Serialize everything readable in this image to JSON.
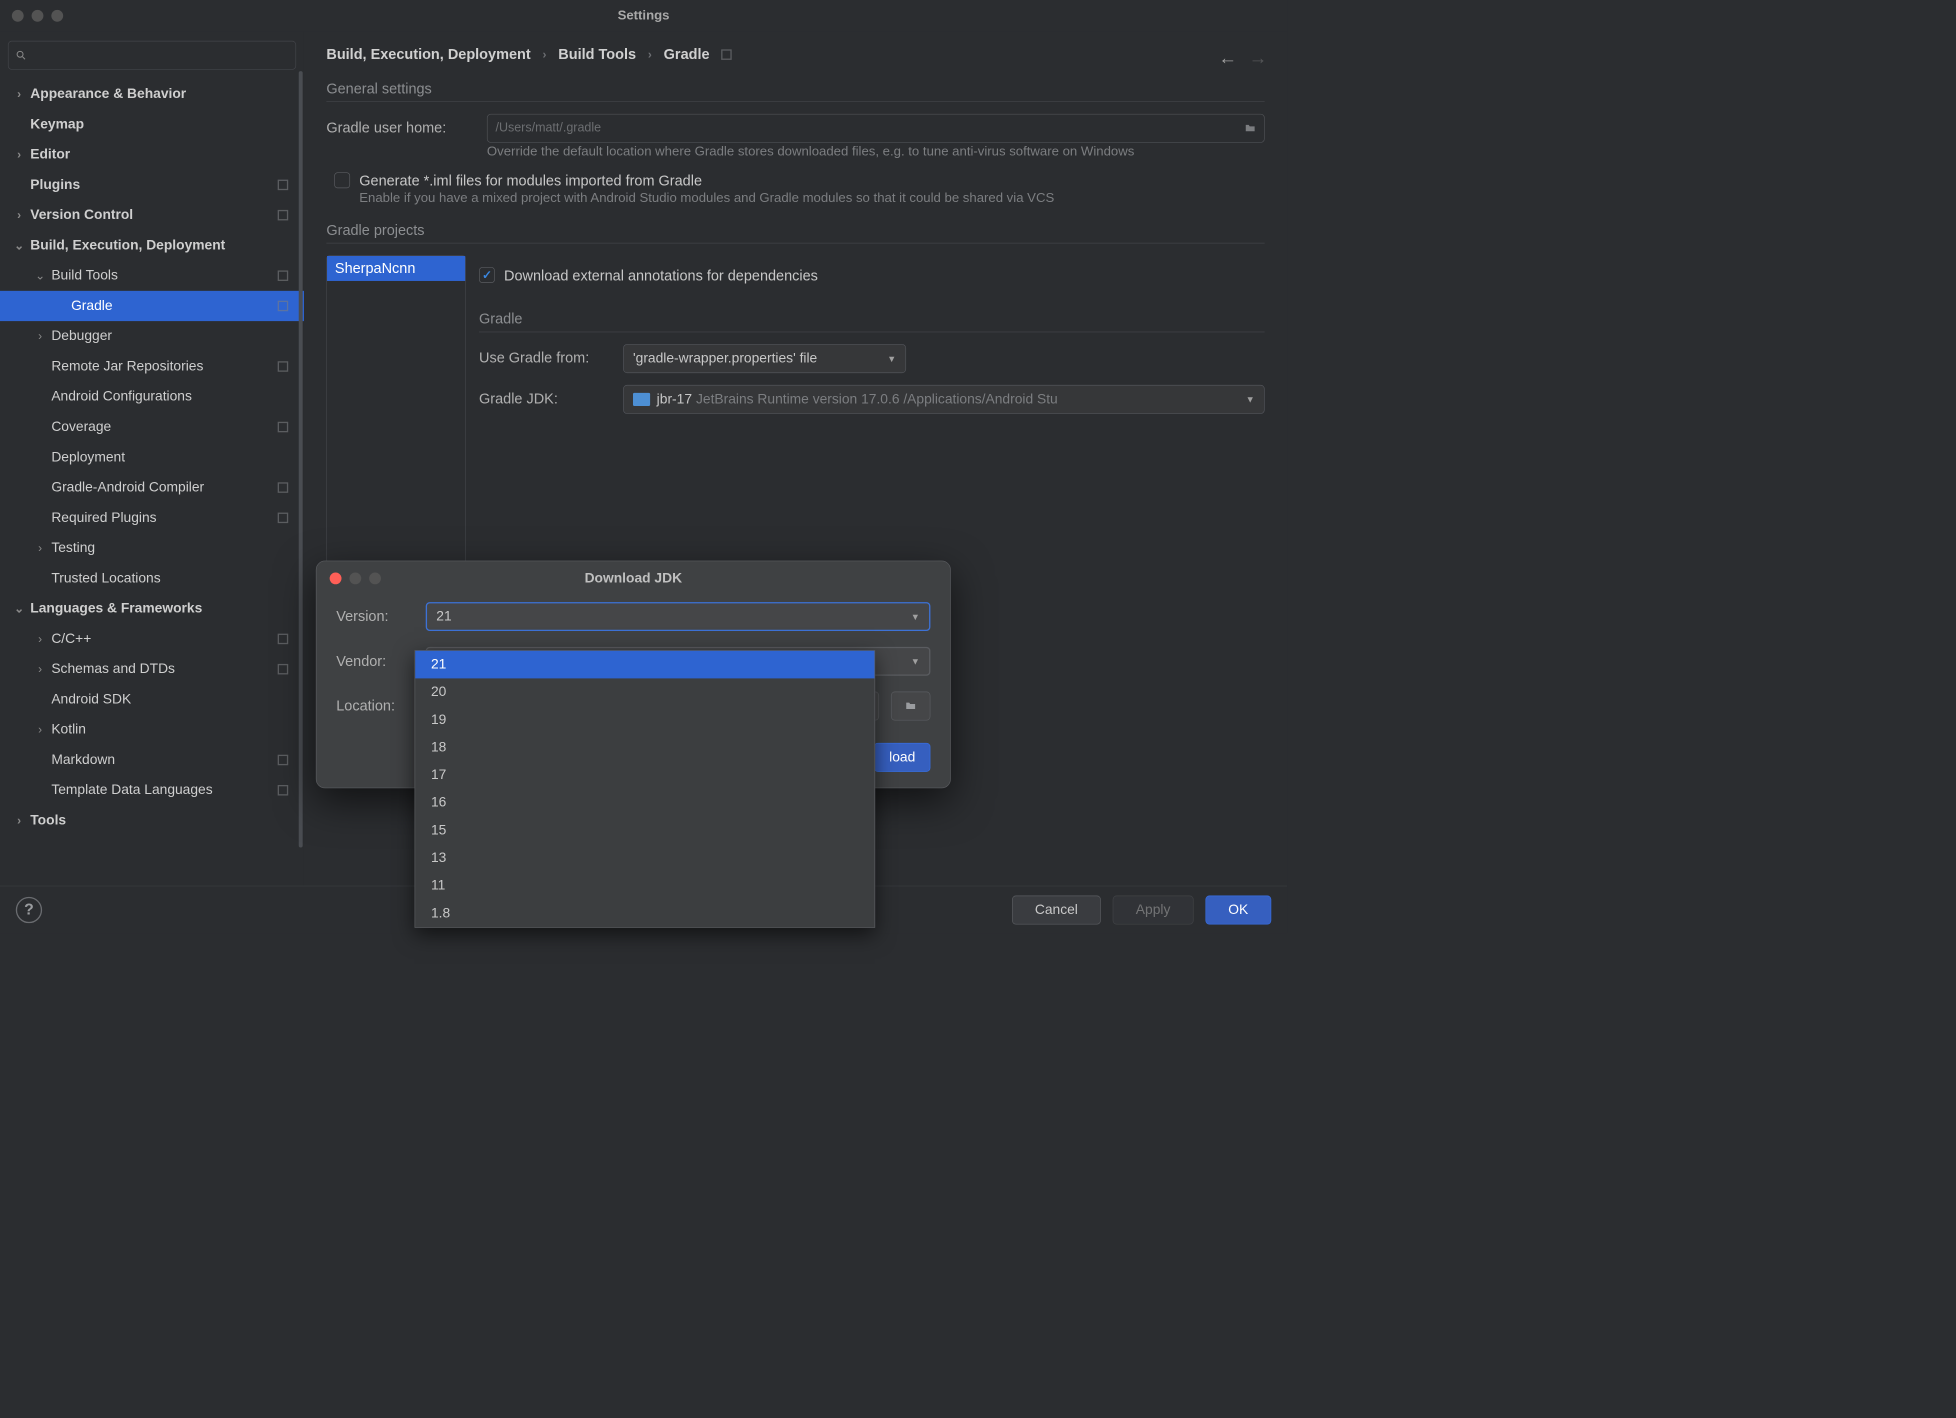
{
  "window": {
    "title": "Settings"
  },
  "breadcrumbs": {
    "a": "Build, Execution, Deployment",
    "b": "Build Tools",
    "c": "Gradle"
  },
  "sidebar": {
    "items": [
      {
        "label": "Appearance & Behavior",
        "level": 1,
        "bold": true,
        "expand": "right"
      },
      {
        "label": "Keymap",
        "level": 1,
        "bold": true
      },
      {
        "label": "Editor",
        "level": 1,
        "bold": true,
        "expand": "right"
      },
      {
        "label": "Plugins",
        "level": 1,
        "bold": true,
        "icon": true
      },
      {
        "label": "Version Control",
        "level": 1,
        "bold": true,
        "expand": "right",
        "icon": true
      },
      {
        "label": "Build, Execution, Deployment",
        "level": 1,
        "bold": true,
        "expand": "down"
      },
      {
        "label": "Build Tools",
        "level": 2,
        "expand": "down",
        "icon": true
      },
      {
        "label": "Gradle",
        "level": 3,
        "selected": true,
        "icon": true
      },
      {
        "label": "Debugger",
        "level": 2,
        "expand": "right"
      },
      {
        "label": "Remote Jar Repositories",
        "level": 2,
        "icon": true
      },
      {
        "label": "Android Configurations",
        "level": 2
      },
      {
        "label": "Coverage",
        "level": 2,
        "icon": true
      },
      {
        "label": "Deployment",
        "level": 2
      },
      {
        "label": "Gradle-Android Compiler",
        "level": 2,
        "icon": true
      },
      {
        "label": "Required Plugins",
        "level": 2,
        "icon": true
      },
      {
        "label": "Testing",
        "level": 2,
        "expand": "right"
      },
      {
        "label": "Trusted Locations",
        "level": 2
      },
      {
        "label": "Languages & Frameworks",
        "level": 1,
        "bold": true,
        "expand": "down"
      },
      {
        "label": "C/C++",
        "level": 2,
        "expand": "right",
        "icon": true
      },
      {
        "label": "Schemas and DTDs",
        "level": 2,
        "expand": "right",
        "icon": true
      },
      {
        "label": "Android SDK",
        "level": 2
      },
      {
        "label": "Kotlin",
        "level": 2,
        "expand": "right"
      },
      {
        "label": "Markdown",
        "level": 2,
        "icon": true
      },
      {
        "label": "Template Data Languages",
        "level": 2,
        "icon": true
      },
      {
        "label": "Tools",
        "level": 1,
        "bold": true,
        "expand": "right"
      }
    ]
  },
  "general": {
    "section": "General settings",
    "user_home_label": "Gradle user home:",
    "user_home_placeholder": "/Users/matt/.gradle",
    "override_help": "Override the default location where Gradle stores downloaded files, e.g. to tune anti-virus software on Windows",
    "iml_label": "Generate *.iml files for modules imported from Gradle",
    "iml_help": "Enable if you have a mixed project with Android Studio modules and Gradle modules so that it could be shared via VCS"
  },
  "projects": {
    "section": "Gradle projects",
    "item": "SherpaNcnn",
    "download_annotations": "Download external annotations for dependencies",
    "gradle_header": "Gradle",
    "use_from_label": "Use Gradle from:",
    "use_from_value": "'gradle-wrapper.properties' file",
    "jdk_label": "Gradle JDK:",
    "jdk_prefix": "jbr-17",
    "jdk_rest": "JetBrains Runtime version 17.0.6 /Applications/Android Stu"
  },
  "modal": {
    "title": "Download JDK",
    "version_label": "Version:",
    "version_value": "21",
    "vendor_label": "Vendor:",
    "location_label": "Location:",
    "download_btn": "load",
    "options": [
      "21",
      "20",
      "19",
      "18",
      "17",
      "16",
      "15",
      "13",
      "11",
      "1.8"
    ]
  },
  "buttons": {
    "cancel": "Cancel",
    "apply": "Apply",
    "ok": "OK",
    "help": "?"
  }
}
